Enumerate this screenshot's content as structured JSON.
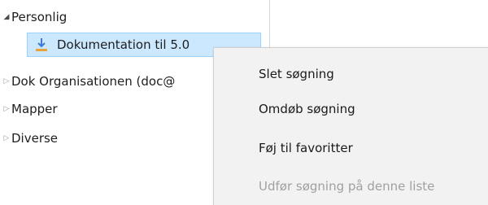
{
  "tree": {
    "items": [
      {
        "label": "Personlig",
        "expanded": true
      },
      {
        "label": "Dokumentation til 5.0",
        "icon": "download-icon",
        "selected": true
      },
      {
        "label": "Dok Organisationen (doc@"
      },
      {
        "label": "Mapper"
      },
      {
        "label": "Diverse"
      }
    ],
    "expanded_arrow": "◢",
    "collapsed_arrow": "▷"
  },
  "context_menu": {
    "items": [
      {
        "label": "Slet søgning",
        "enabled": true
      },
      {
        "label": "Omdøb søgning",
        "enabled": true
      },
      {
        "label": "Føj til favoritter",
        "enabled": true
      },
      {
        "label": "Udfør søgning på denne liste",
        "enabled": false
      }
    ]
  },
  "colors": {
    "selection_bg": "#cce8ff",
    "selection_border": "#99d1ff",
    "menu_bg": "#f2f2f2",
    "disabled_text": "#a0a0a0",
    "icon_accent": "#e8a33c"
  }
}
